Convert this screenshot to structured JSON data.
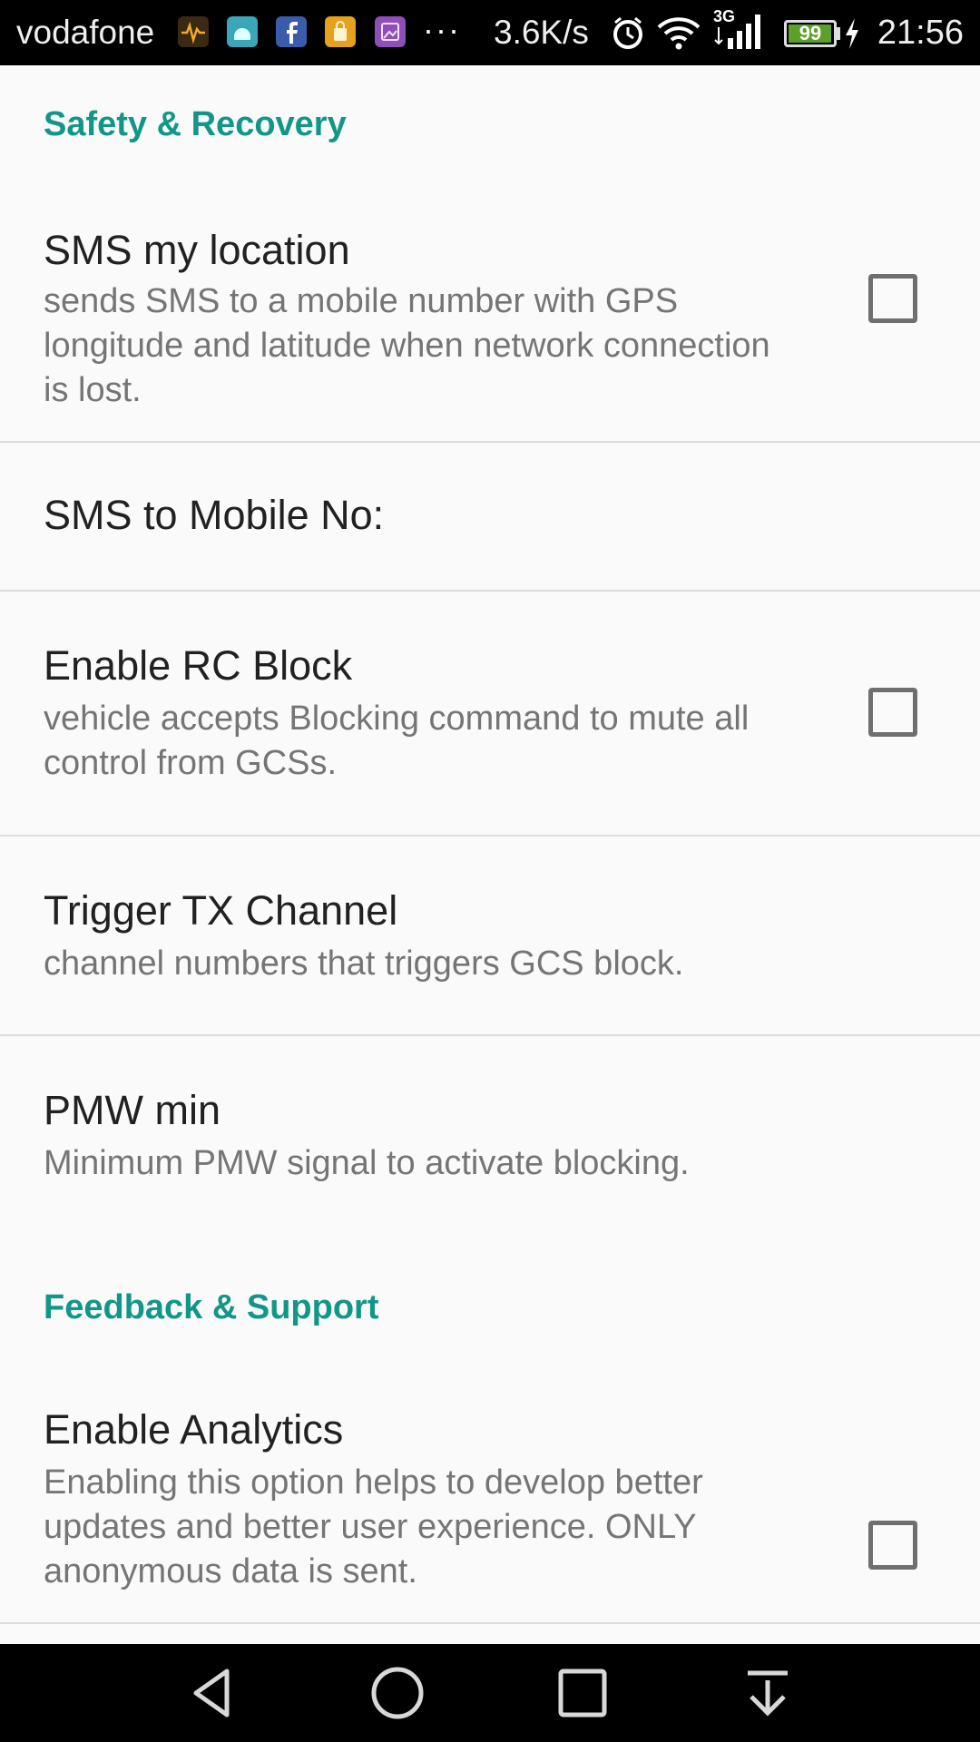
{
  "status_bar": {
    "carrier": "vodafone",
    "notification_icons": [
      {
        "name": "health-app-icon",
        "color": "#5a3a1a"
      },
      {
        "name": "android-app-icon",
        "color": "#3aa6b8"
      },
      {
        "name": "facebook-icon",
        "color": "#3b5bab"
      },
      {
        "name": "shopping-app-icon",
        "color": "#e6a21c"
      },
      {
        "name": "gallery-app-icon",
        "color": "#8f4fb8"
      }
    ],
    "more_indicator": "···",
    "net_speed": "3.6K/s",
    "network_type": "3G",
    "battery_level": 99,
    "battery_label": "99",
    "time": "21:56"
  },
  "colors": {
    "accent": "#129688",
    "title_text": "#212121",
    "summary_text": "#757575",
    "background": "#fafafa"
  },
  "settings": {
    "safety_header": "Safety & Recovery",
    "sms_location": {
      "title": "SMS my location",
      "summary": "sends SMS to a mobile number with GPS longitude and latitude when network connection is lost.",
      "checked": false
    },
    "sms_mobile_no": {
      "title": "SMS to Mobile No:"
    },
    "rc_block": {
      "title": "Enable RC Block",
      "summary": "vehicle accepts Blocking command to mute all control from GCSs.",
      "checked": false
    },
    "trigger_tx": {
      "title": "Trigger TX Channel",
      "summary": "channel numbers that triggers GCS block."
    },
    "pmw_min": {
      "title": "PMW min",
      "summary": "Minimum PMW signal to activate blocking."
    },
    "feedback_header": "Feedback & Support",
    "analytics": {
      "title": "Enable Analytics",
      "summary": "Enabling this option helps to develop better updates and better user experience. ONLY anonymous data is sent.",
      "checked": false
    }
  },
  "nav_bar": {
    "buttons": [
      "back-icon",
      "home-icon",
      "recents-icon",
      "notification-pull-icon"
    ]
  }
}
